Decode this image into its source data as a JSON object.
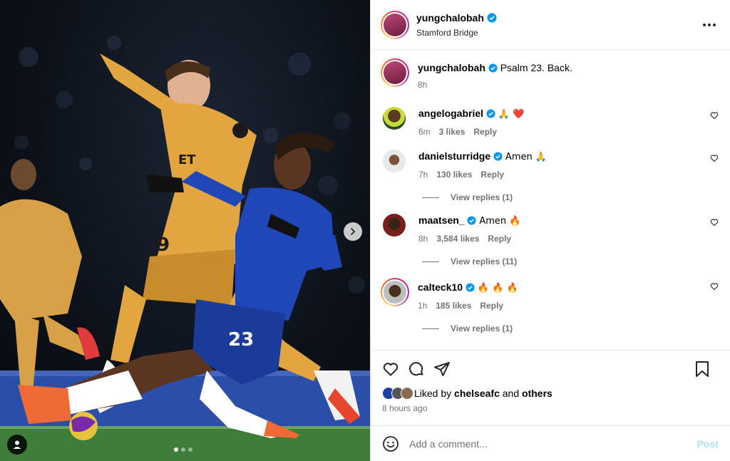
{
  "post": {
    "author": "yungchalobah",
    "location": "Stamford Bridge",
    "caption_author": "yungchalobah",
    "caption": "Psalm 23. Back.",
    "caption_time": "8h"
  },
  "comments": [
    {
      "user": "angelogabriel",
      "text": "🙏 ❤️",
      "time": "6m",
      "likes": "3 likes",
      "reply": "Reply",
      "view_replies": ""
    },
    {
      "user": "danielsturridge",
      "text": "Amen 🙏",
      "time": "7h",
      "likes": "130 likes",
      "reply": "Reply",
      "view_replies": "View replies (1)"
    },
    {
      "user": "maatsen_",
      "text": "Amen 🔥",
      "time": "8h",
      "likes": "3,584 likes",
      "reply": "Reply",
      "view_replies": "View replies (11)"
    },
    {
      "user": "calteck10",
      "text": "🔥 🔥 🔥",
      "time": "1h",
      "likes": "185 likes",
      "reply": "Reply",
      "view_replies": "View replies (1)"
    }
  ],
  "likes_line": {
    "prefix": "Liked by",
    "user": "chelseafc",
    "joiner": "and",
    "suffix": "others"
  },
  "timestamp": "8 hours ago",
  "comment_box": {
    "placeholder": "Add a comment...",
    "post_label": "Post"
  },
  "carousel": {
    "count": 3,
    "active": 0
  },
  "colors": {
    "verified": "#0095f6",
    "post_disabled": "#b2dffc",
    "chelsea_blue": "#1d3fa8",
    "wolves_gold": "#e0a43a"
  }
}
